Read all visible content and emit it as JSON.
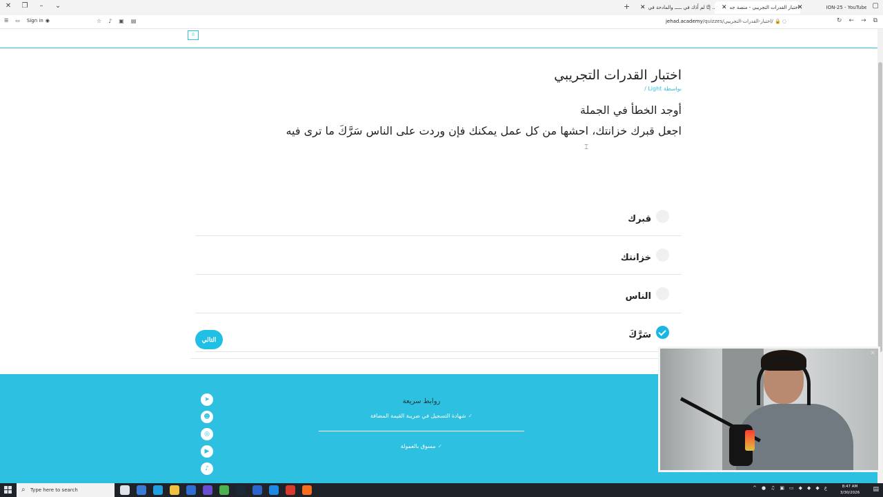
{
  "browser": {
    "tabs": [
      {
        "title": "ION-25 - YouTube"
      },
      {
        "title": "اختبار القدرات التجريبي - منصة جه"
      },
      {
        "title": "إنَّا لم أَدَك في ـــــ والمادحة في ..."
      }
    ],
    "sign_in": "Sign in",
    "url_host": "jehad.academy",
    "url_path": "/quizzes/اختبار-القدرات-التجريبي/"
  },
  "page": {
    "counter": "0",
    "quiz_title": "اختبار القدرات التجريبي",
    "author": "بواسطة Light /",
    "question_prompt": "أوجد الخطأ في الجملة",
    "question_sentence": "اجعل قبرك خزانتك، احشها من كل عمل يمكنك فإن وردت على الناس سَرَّكَ ما ترى فيه",
    "options": [
      {
        "label": "قبرك",
        "selected": false
      },
      {
        "label": "خزانتك",
        "selected": false
      },
      {
        "label": "الناس",
        "selected": false
      },
      {
        "label": "سَرَّكَ",
        "selected": true
      }
    ],
    "next_button": "التالي"
  },
  "footer": {
    "links_title": "روابط سريعة",
    "links": [
      "شهادة التسجيل في ضريبة القيمة المضافة",
      "مسوق بالعمولة"
    ],
    "social": [
      "telegram-icon",
      "snapchat-icon",
      "instagram-icon",
      "youtube-icon",
      "tiktok-icon"
    ]
  },
  "taskbar": {
    "search_placeholder": "Type here to search",
    "time": "8:47 AM",
    "date": "3/30/2026"
  },
  "colors": {
    "accent": "#2ec0e0",
    "button": "#1fbfe6",
    "checked": "#19b6e4"
  }
}
